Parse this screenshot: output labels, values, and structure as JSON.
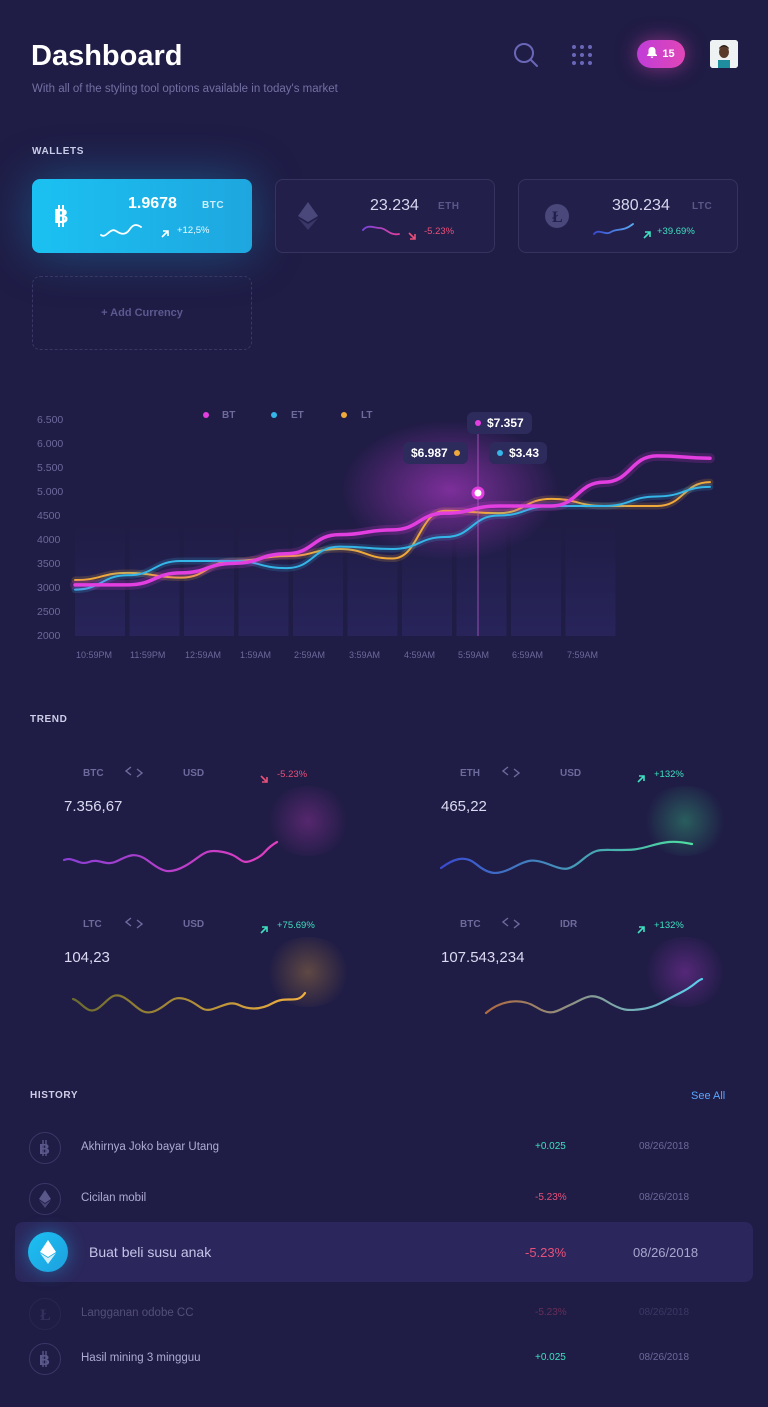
{
  "header": {
    "title": "Dashboard",
    "subtitle": "With all of the styling tool options available in today's market",
    "notifications": "15"
  },
  "wallets": {
    "label": "WALLETS",
    "items": [
      {
        "amount": "1.9678",
        "code": "BTC",
        "change": "+12,5%",
        "icon": "bitcoin-icon"
      },
      {
        "amount": "23.234",
        "code": "ETH",
        "change": "-5.23%",
        "icon": "ethereum-icon"
      },
      {
        "amount": "380.234",
        "code": "LTC",
        "change": "+39.69%",
        "icon": "litecoin-icon"
      }
    ],
    "add_label": "+ Add Currency"
  },
  "chart_data": {
    "type": "line",
    "y_ticks": [
      "6.500",
      "6.000",
      "5.500",
      "5.000",
      "4500",
      "4000",
      "3500",
      "3000",
      "2500",
      "2000"
    ],
    "x_ticks": [
      "10:59PM",
      "11:59PM",
      "12:59AM",
      "1:59AM",
      "2:59AM",
      "3:59AM",
      "4:59AM",
      "5:59AM",
      "6:59AM",
      "7:59AM"
    ],
    "ylim": [
      2000,
      6500
    ],
    "legend": [
      "BT",
      "ET",
      "LT"
    ],
    "colors": {
      "BT": "#e33ee0",
      "ET": "#35b6e8",
      "LT": "#f0a93a"
    },
    "series": [
      {
        "name": "BT",
        "values": [
          3050,
          3050,
          3300,
          3500,
          3700,
          4100,
          4200,
          4550,
          4700,
          4700,
          5200,
          5750,
          5700
        ]
      },
      {
        "name": "ET",
        "values": [
          2950,
          3250,
          3550,
          3550,
          3400,
          3850,
          3800,
          4050,
          4500,
          4700,
          4700,
          4900,
          5100
        ]
      },
      {
        "name": "LT",
        "values": [
          3150,
          3300,
          3200,
          3550,
          3650,
          3800,
          3600,
          4600,
          4550,
          4850,
          4700,
          4700,
          5200
        ]
      }
    ],
    "tooltips": [
      {
        "label": "$7.357",
        "series": "BT"
      },
      {
        "label": "$6.987",
        "series": "LT"
      },
      {
        "label": "$3.43",
        "series": "ET"
      }
    ]
  },
  "trend": {
    "label": "TREND",
    "items": [
      {
        "from": "BTC",
        "to": "USD",
        "change": "-5.23%",
        "value": "7.356,67"
      },
      {
        "from": "ETH",
        "to": "USD",
        "change": "+132%",
        "value": "465,22"
      },
      {
        "from": "LTC",
        "to": "USD",
        "change": "+75.69%",
        "value": "104,23"
      },
      {
        "from": "BTC",
        "to": "IDR",
        "change": "+132%",
        "value": "107.543,234"
      }
    ]
  },
  "history": {
    "label": "HISTORY",
    "see_all": "See All",
    "items": [
      {
        "name": "Akhirnya Joko bayar Utang",
        "amount": "+0.025",
        "date": "08/26/2018",
        "icon": "bitcoin-icon"
      },
      {
        "name": "Cicilan mobil",
        "amount": "-5.23%",
        "date": "08/26/2018",
        "icon": "ethereum-icon"
      },
      {
        "name": "Buat beli susu anak",
        "amount": "-5.23%",
        "date": "08/26/2018",
        "icon": "ethereum-icon"
      },
      {
        "name": "Langganan odobe CC",
        "amount": "-5.23%",
        "date": "08/26/2018",
        "icon": "litecoin-icon"
      },
      {
        "name": "Hasil mining 3 mingguu",
        "amount": "+0.025",
        "date": "08/26/2018",
        "icon": "bitcoin-icon"
      }
    ]
  }
}
